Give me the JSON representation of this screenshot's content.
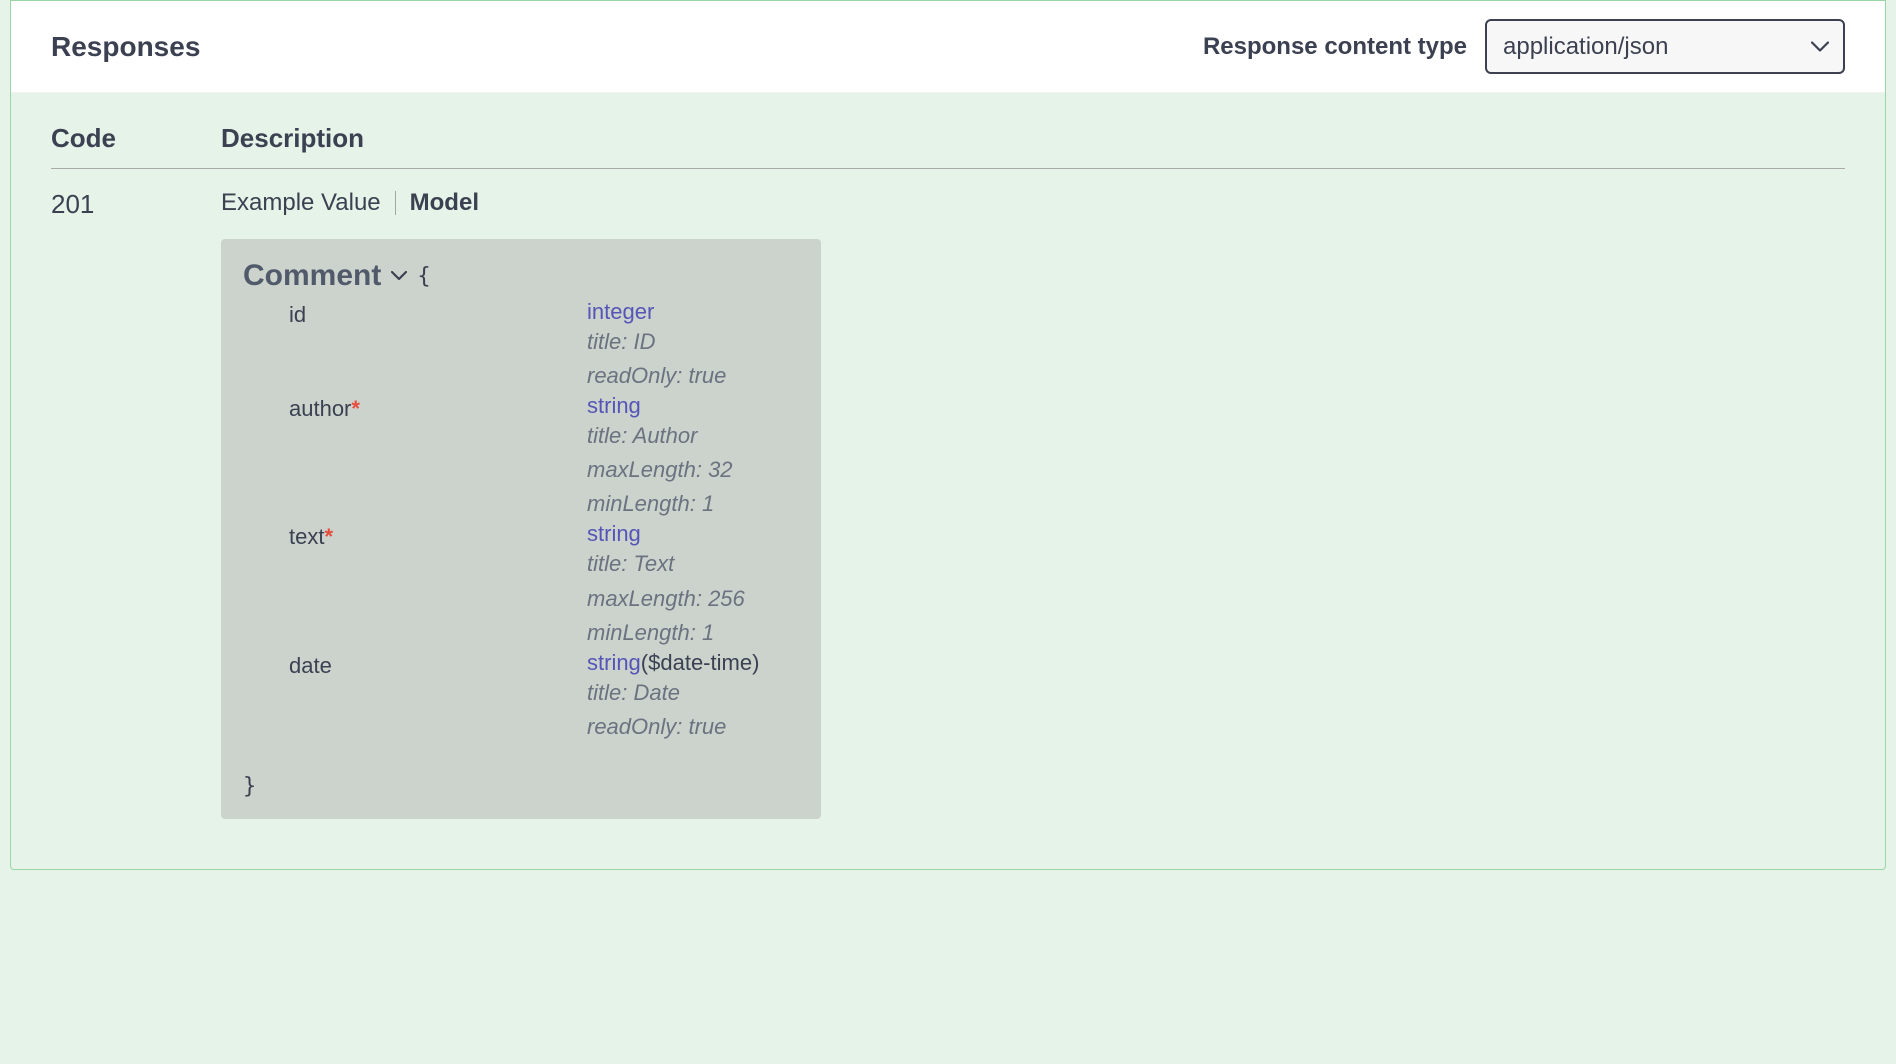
{
  "header": {
    "title": "Responses",
    "contentTypeLabel": "Response content type",
    "contentTypeValue": "application/json"
  },
  "tableHeaders": {
    "code": "Code",
    "description": "Description"
  },
  "response": {
    "code": "201",
    "tabs": {
      "example": "Example Value",
      "model": "Model"
    },
    "model": {
      "name": "Comment",
      "openBrace": "{",
      "closeBrace": "}",
      "properties": [
        {
          "name": "id",
          "required": false,
          "type": "integer",
          "format": "",
          "meta": [
            "title: ID",
            "readOnly: true"
          ]
        },
        {
          "name": "author",
          "required": true,
          "type": "string",
          "format": "",
          "meta": [
            "title: Author",
            "maxLength: 32",
            "minLength: 1"
          ]
        },
        {
          "name": "text",
          "required": true,
          "type": "string",
          "format": "",
          "meta": [
            "title: Text",
            "maxLength: 256",
            "minLength: 1"
          ]
        },
        {
          "name": "date",
          "required": false,
          "type": "string",
          "format": "($date-time)",
          "meta": [
            "title: Date",
            "readOnly: true"
          ]
        }
      ]
    }
  }
}
